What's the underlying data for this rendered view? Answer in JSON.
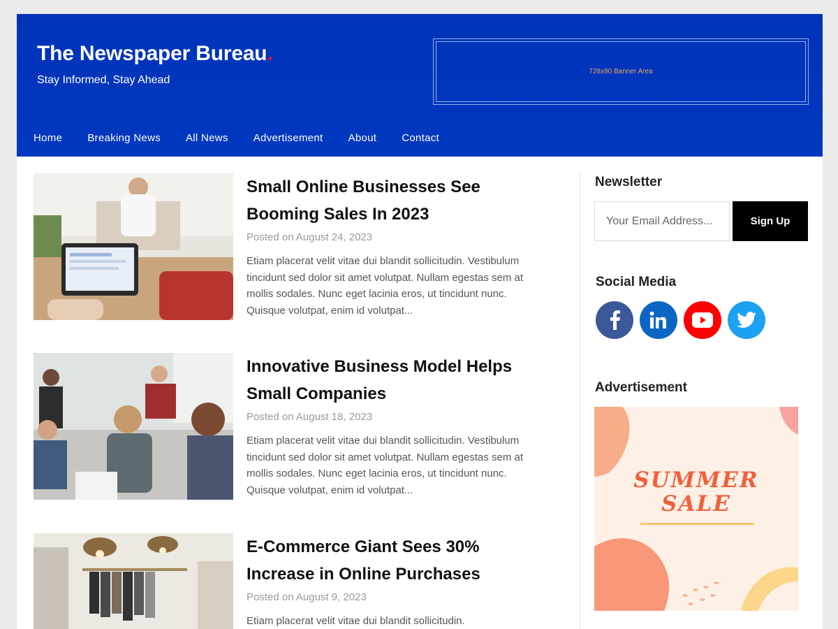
{
  "header": {
    "site_title": "The Newspaper Bureau",
    "site_title_dot": ".",
    "tagline": "Stay Informed, Stay Ahead",
    "banner_text": "728x90 Banner Area"
  },
  "nav": {
    "items": [
      "Home",
      "Breaking News",
      "All News",
      "Advertisement",
      "About",
      "Contact"
    ]
  },
  "articles": [
    {
      "title": "Small Online Businesses See Booming Sales In 2023",
      "date": "Posted on August 24, 2023",
      "excerpt": "Etiam placerat velit vitae dui blandit sollicitudin. Vestibulum tincidunt sed dolor sit amet volutpat. Nullam egestas sem at mollis sodales. Nunc eget lacinia eros, ut tincidunt nunc. Quisque volutpat, enim id volutpat..."
    },
    {
      "title": "Innovative Business Model Helps Small Companies",
      "date": "Posted on August 18, 2023",
      "excerpt": "Etiam placerat velit vitae dui blandit sollicitudin. Vestibulum tincidunt sed dolor sit amet volutpat. Nullam egestas sem at mollis sodales. Nunc eget lacinia eros, ut tincidunt nunc. Quisque volutpat, enim id volutpat..."
    },
    {
      "title": "E-Commerce Giant Sees 30% Increase in Online Purchases",
      "date": "Posted on August 9, 2023",
      "excerpt": "Etiam placerat velit vitae dui blandit sollicitudin."
    }
  ],
  "sidebar": {
    "newsletter": {
      "heading": "Newsletter",
      "placeholder": "Your Email Address...",
      "button": "Sign Up"
    },
    "social": {
      "heading": "Social Media",
      "items": [
        {
          "icon": "facebook-icon",
          "color": "#3b5998"
        },
        {
          "icon": "linkedin-icon",
          "color": "#0a66c2"
        },
        {
          "icon": "youtube-icon",
          "color": "#ff0000"
        },
        {
          "icon": "twitter-icon",
          "color": "#1da1f2"
        }
      ]
    },
    "advertisement": {
      "heading": "Advertisement",
      "ad_line1": "SUMMER",
      "ad_line2": "SALE"
    }
  },
  "colors": {
    "brand_blue": "#0033b8",
    "accent_red": "#e8163b"
  }
}
